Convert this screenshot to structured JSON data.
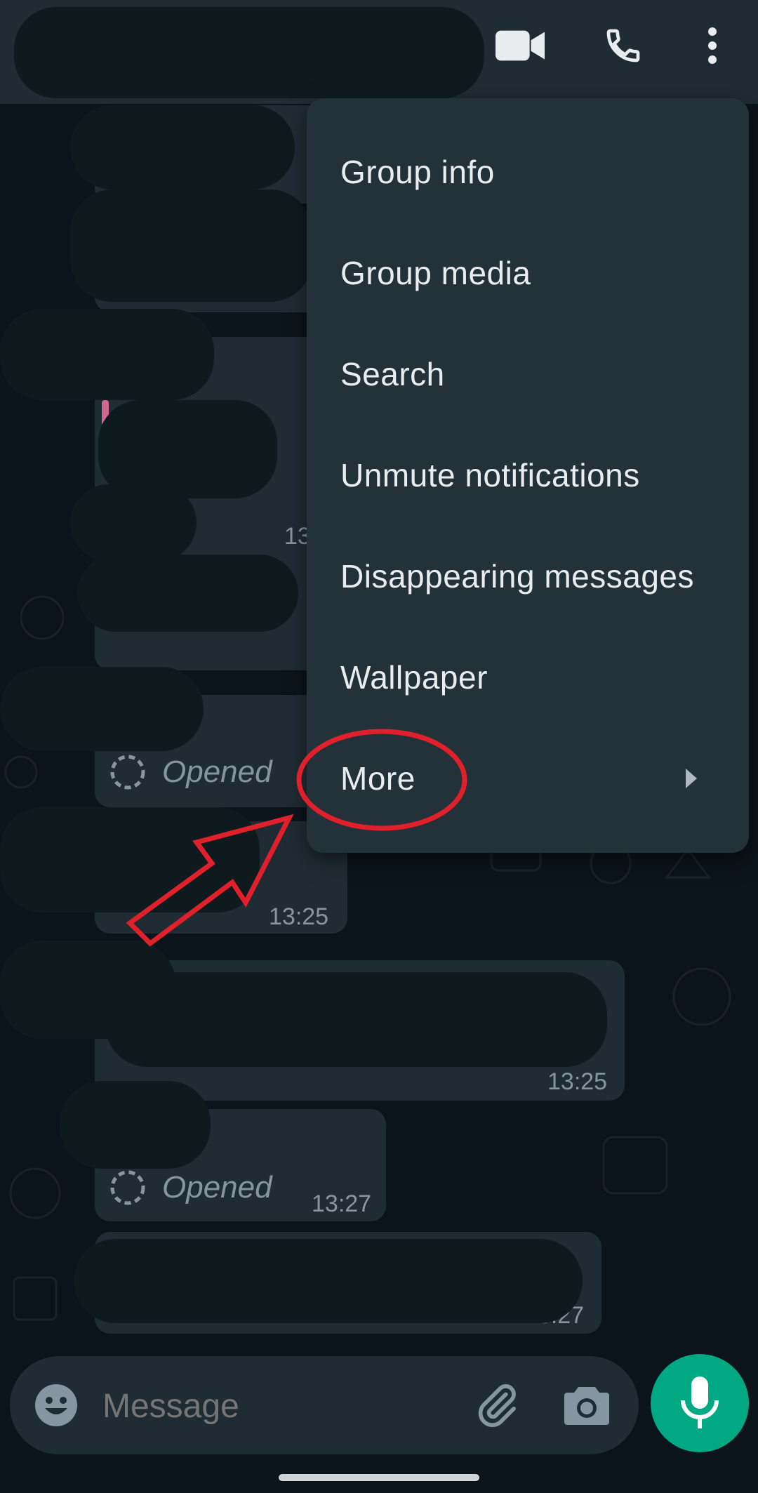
{
  "header": {
    "video_call_icon": "video-camera-icon",
    "voice_call_icon": "phone-icon",
    "more_icon": "vertical-dots-icon"
  },
  "menu": {
    "items": [
      {
        "label": "Group info"
      },
      {
        "label": "Group media"
      },
      {
        "label": "Search"
      },
      {
        "label": "Unmute notifications"
      },
      {
        "label": "Disappearing messages"
      },
      {
        "label": "Wallpaper"
      },
      {
        "label": "More"
      }
    ]
  },
  "messages": {
    "partial_time_1": "13",
    "opened_1": "Opened",
    "time_2": "13:25",
    "time_3": "13:25",
    "opened_2": "Opened",
    "time_4": "13:27",
    "time_5": "13:27"
  },
  "composer": {
    "placeholder": "Message"
  },
  "colors": {
    "accent": "#00a884",
    "header_bg": "#1f2c34",
    "menu_bg": "#233138",
    "annotation": "#e0202a"
  }
}
